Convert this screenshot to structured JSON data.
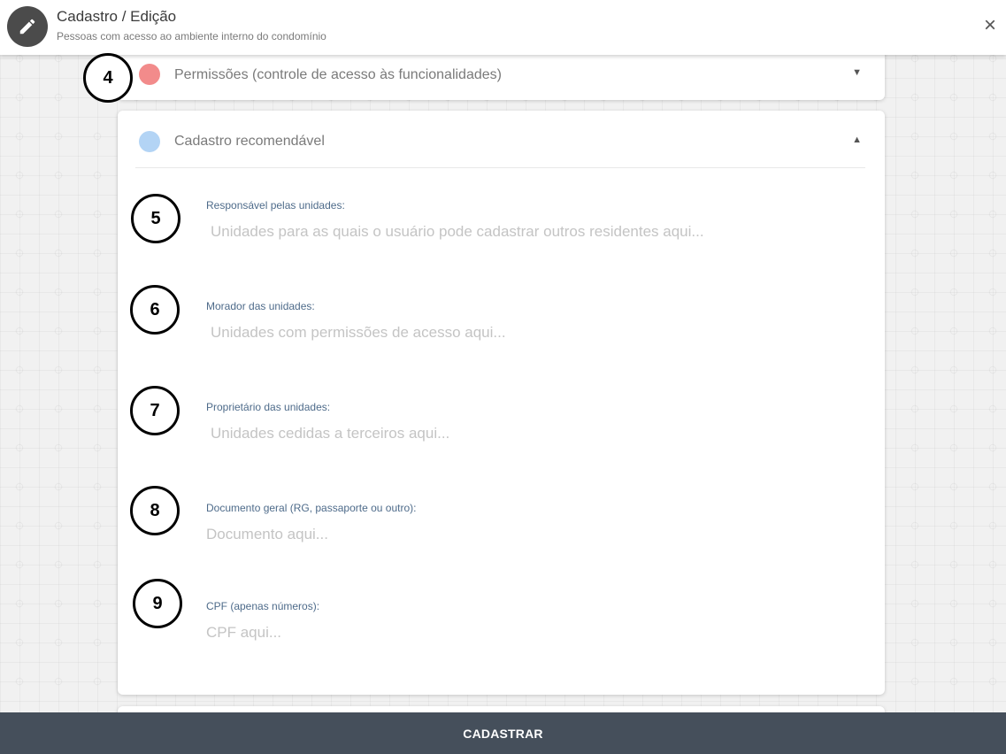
{
  "header": {
    "title": "Cadastro / Edição",
    "subtitle": "Pessoas com acesso ao ambiente interno do condomínio",
    "close_label": "×"
  },
  "sections": {
    "permissoes": {
      "title": "Permissões (controle de acesso às funcionalidades)",
      "color": "#f28b8b",
      "caret": "▼"
    },
    "cadastro": {
      "title": "Cadastro recomendável",
      "color": "#b3d4f5",
      "caret": "▲"
    }
  },
  "markers": [
    "4",
    "5",
    "6",
    "7",
    "8",
    "9"
  ],
  "fields": [
    {
      "label": "Responsável pelas unidades:",
      "placeholder": "Unidades para as quais o usuário pode cadastrar outros residentes aqui..."
    },
    {
      "label": "Morador das unidades:",
      "placeholder": "Unidades com permissões de acesso aqui..."
    },
    {
      "label": "Proprietário das unidades:",
      "placeholder": "Unidades cedidas a terceiros aqui..."
    },
    {
      "label": "Documento geral (RG, passaporte ou outro):",
      "placeholder": "Documento aqui..."
    },
    {
      "label": "CPF (apenas números):",
      "placeholder": "CPF aqui..."
    }
  ],
  "submit_label": "CADASTRAR",
  "colors": {
    "header_icon_bg": "#4b4b4b",
    "label": "#4e6b8a",
    "submit_bg": "#454f5b"
  }
}
